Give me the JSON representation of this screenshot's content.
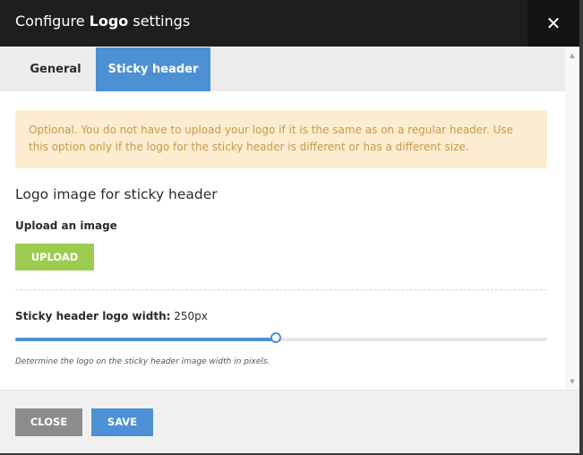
{
  "modal": {
    "title_prefix": "Configure ",
    "title_bold": "Logo",
    "title_suffix": " settings",
    "close_icon": "close-icon"
  },
  "tabs": [
    {
      "label": "General",
      "active": false
    },
    {
      "label": "Sticky header",
      "active": true
    }
  ],
  "notice": {
    "text": "Optional. You do not have to upload your logo if it is the same as on a regular header. Use this option only if the logo for the sticky header is different or has a different size."
  },
  "section": {
    "title": "Logo image for sticky header",
    "upload_label": "Upload an image",
    "upload_button": "UPLOAD"
  },
  "width_setting": {
    "label": "Sticky header logo width:",
    "value_text": "250px",
    "slider_fraction": 0.49,
    "help": "Determine the logo on the sticky header image width in pixels."
  },
  "footer": {
    "close_label": "CLOSE",
    "save_label": "SAVE"
  },
  "colors": {
    "accent": "#4e90d4",
    "upload_green": "#9ccc4f",
    "notice_bg": "#fdeccf",
    "notice_text": "#c49a4a",
    "header_bg": "#1e1e1e"
  }
}
